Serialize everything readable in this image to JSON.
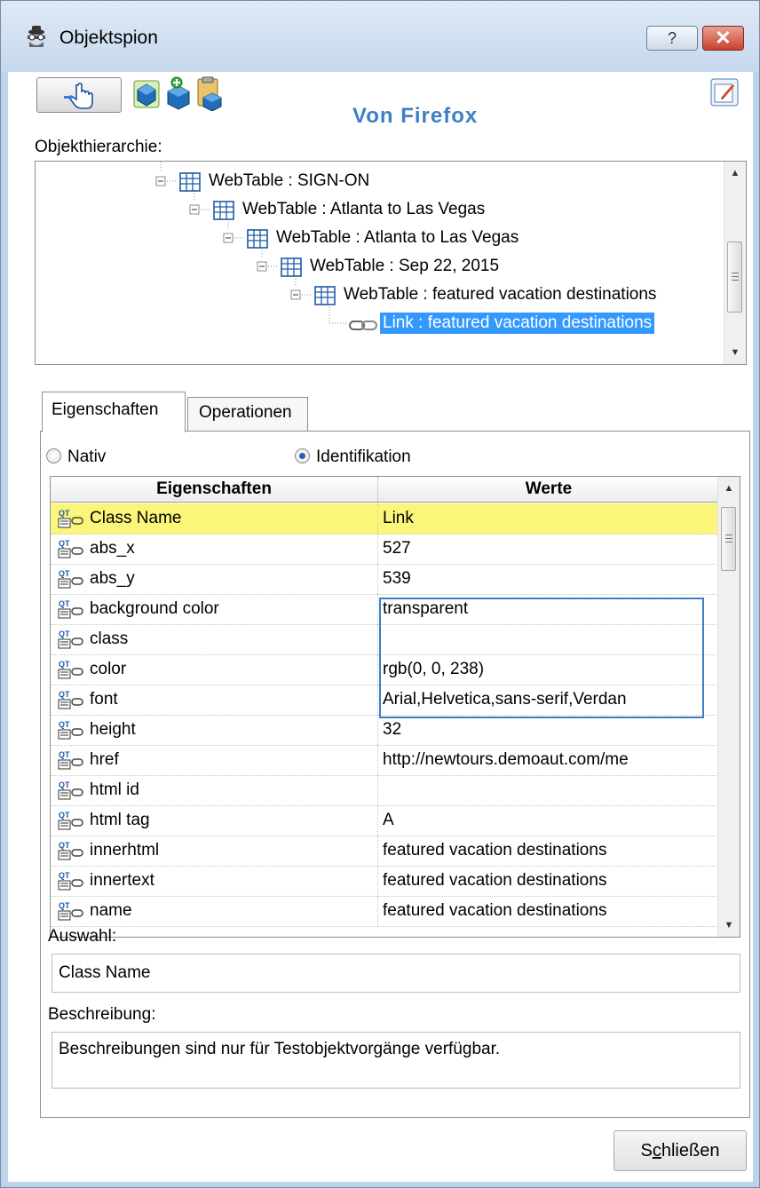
{
  "window": {
    "title": "Objektspion",
    "help_glyph": "?",
    "close_glyph": "✕"
  },
  "toolbar": {
    "source_label": "Von Firefox"
  },
  "hierarchy": {
    "label": "Objekthierarchie:",
    "nodes": [
      {
        "text": "WebTable : SIGN-ON",
        "icon": "table-icon",
        "expanded": true
      },
      {
        "text": "WebTable : Atlanta to Las Vegas",
        "icon": "table-icon",
        "expanded": true
      },
      {
        "text": "WebTable : Atlanta to Las Vegas",
        "icon": "table-icon",
        "expanded": true
      },
      {
        "text": "WebTable : Sep 22, 2015",
        "icon": "table-icon",
        "expanded": true
      },
      {
        "text": "WebTable : featured vacation destinations",
        "icon": "table-icon",
        "expanded": true
      },
      {
        "text": "Link : featured vacation destinations",
        "icon": "link-icon",
        "selected": true
      }
    ]
  },
  "tabs": {
    "properties": "Eigenschaften",
    "operations": "Operationen"
  },
  "mode": {
    "native": "Nativ",
    "identification": "Identifikation",
    "selected": "Identifikation"
  },
  "grid": {
    "headers": {
      "property": "Eigenschaften",
      "value": "Werte"
    },
    "rows": [
      {
        "name": "Class Name",
        "value": "Link"
      },
      {
        "name": "abs_x",
        "value": "527"
      },
      {
        "name": "abs_y",
        "value": "539"
      },
      {
        "name": "background color",
        "value": "transparent"
      },
      {
        "name": "class",
        "value": ""
      },
      {
        "name": "color",
        "value": "rgb(0, 0, 238)"
      },
      {
        "name": "font",
        "value": "Arial,Helvetica,sans-serif,Verdan"
      },
      {
        "name": "height",
        "value": "32"
      },
      {
        "name": "href",
        "value": "http://newtours.demoaut.com/me"
      },
      {
        "name": "html id",
        "value": ""
      },
      {
        "name": "html tag",
        "value": "A"
      },
      {
        "name": "innerhtml",
        "value": "featured vacation destinations"
      },
      {
        "name": "innertext",
        "value": "featured vacation destinations"
      },
      {
        "name": "name",
        "value": "featured vacation destinations"
      }
    ]
  },
  "selection": {
    "label": "Auswahl:",
    "value": "Class Name"
  },
  "description": {
    "label": "Beschreibung:",
    "value": "Beschreibungen sind nur für Testobjektvorgänge verfügbar."
  },
  "footer": {
    "close_label_pre": "S",
    "close_label_accel": "c",
    "close_label_post": "hließen"
  },
  "colors": {
    "accent": "#3f7fc6",
    "selection_bg": "#3399ff",
    "highlight_row": "#fbf67a"
  }
}
